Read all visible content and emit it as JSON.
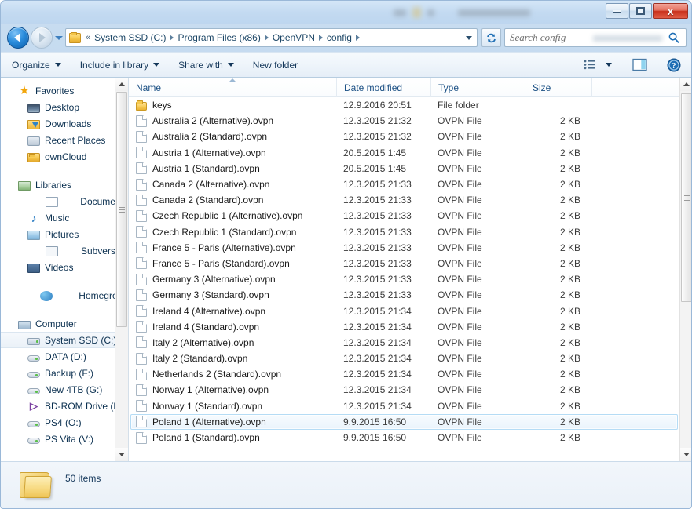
{
  "window": {
    "titlebar_redacted": true,
    "minimize_label": "Minimize",
    "maximize_label": "Maximize",
    "close_label": "x"
  },
  "addressbar": {
    "back_label": "Back",
    "forward_label": "Forward",
    "history_label": "Recent pages",
    "folder_icon": "folder-icon",
    "overflow_chevron": "«",
    "crumbs": [
      {
        "label": "System SSD (C:)"
      },
      {
        "label": "Program Files (x86)"
      },
      {
        "label": "OpenVPN"
      },
      {
        "label": "config"
      }
    ],
    "dropdown_label": "Previous locations",
    "refresh_label": "Refresh",
    "refresh_icon": "refresh-icon"
  },
  "search": {
    "placeholder": "Search config",
    "value": "",
    "icon": "search-icon"
  },
  "toolbar": {
    "items": [
      {
        "label": "Organize",
        "caret": true
      },
      {
        "label": "Include in library",
        "caret": true
      },
      {
        "label": "Share with",
        "caret": true
      },
      {
        "label": "New folder",
        "caret": false
      }
    ],
    "view_icon": "view-list-icon",
    "view_caret_icon": "chevron-down-icon",
    "preview_pane_icon": "preview-pane-icon",
    "help_icon": "help-icon"
  },
  "navpane": {
    "sections": [
      {
        "header": {
          "label": "Favorites",
          "icon": "star-icon",
          "icon_class": "ic-star",
          "glyph": "★"
        },
        "items": [
          {
            "label": "Desktop",
            "icon": "desktop-icon",
            "icon_class": "ic-desktop"
          },
          {
            "label": "Downloads",
            "icon": "downloads-icon",
            "icon_class": "ic-downloads"
          },
          {
            "label": "Recent Places",
            "icon": "recent-places-icon",
            "icon_class": "ic-recent"
          },
          {
            "label": "ownCloud",
            "icon": "folder-icon",
            "icon_class": "ic-folder"
          }
        ]
      },
      {
        "header": {
          "label": "Libraries",
          "icon": "libraries-icon",
          "icon_class": "ic-library",
          "glyph": ""
        },
        "items": [
          {
            "label": "Documents",
            "icon": "documents-icon",
            "icon_class": "ic-doc"
          },
          {
            "label": "Music",
            "icon": "music-icon",
            "icon_class": "ic-music",
            "glyph": "♪"
          },
          {
            "label": "Pictures",
            "icon": "pictures-icon",
            "icon_class": "ic-picture"
          },
          {
            "label": "Subversion",
            "icon": "subversion-icon",
            "icon_class": "ic-subv"
          },
          {
            "label": "Videos",
            "icon": "videos-icon",
            "icon_class": "ic-video"
          }
        ]
      },
      {
        "header": {
          "label": "Homegroup",
          "icon": "homegroup-icon",
          "icon_class": "ic-home",
          "glyph": ""
        },
        "items": []
      },
      {
        "header": {
          "label": "Computer",
          "icon": "computer-icon",
          "icon_class": "ic-computer",
          "glyph": ""
        },
        "items": [
          {
            "label": "System SSD (C:)",
            "icon": "hard-drive-icon",
            "icon_class": "ic-drive-sys",
            "selected": true
          },
          {
            "label": "DATA (D:)",
            "icon": "hard-drive-icon",
            "icon_class": "ic-drive"
          },
          {
            "label": "Backup (F:)",
            "icon": "hard-drive-icon",
            "icon_class": "ic-drive"
          },
          {
            "label": "New 4TB (G:)",
            "icon": "hard-drive-icon",
            "icon_class": "ic-drive"
          },
          {
            "label": "BD-ROM Drive (K",
            "icon": "optical-drive-icon",
            "icon_class": "ic-bd",
            "glyph": "▷"
          },
          {
            "label": "PS4 (O:)",
            "icon": "hard-drive-icon",
            "icon_class": "ic-drive"
          },
          {
            "label": "PS Vita (V:)",
            "icon": "hard-drive-icon",
            "icon_class": "ic-drive"
          }
        ]
      }
    ]
  },
  "filelist": {
    "columns": [
      {
        "id": "name",
        "label": "Name",
        "sorted": true
      },
      {
        "id": "date",
        "label": "Date modified",
        "sorted": false
      },
      {
        "id": "type",
        "label": "Type",
        "sorted": false
      },
      {
        "id": "size",
        "label": "Size",
        "sorted": false
      }
    ],
    "rows": [
      {
        "name": "keys",
        "date": "12.9.2016 20:51",
        "type": "File folder",
        "size": "",
        "kind": "folder"
      },
      {
        "name": "Australia 2 (Alternative).ovpn",
        "date": "12.3.2015 21:32",
        "type": "OVPN File",
        "size": "2 KB",
        "kind": "file"
      },
      {
        "name": "Australia 2 (Standard).ovpn",
        "date": "12.3.2015 21:32",
        "type": "OVPN File",
        "size": "2 KB",
        "kind": "file"
      },
      {
        "name": "Austria 1 (Alternative).ovpn",
        "date": "20.5.2015 1:45",
        "type": "OVPN File",
        "size": "2 KB",
        "kind": "file"
      },
      {
        "name": "Austria 1 (Standard).ovpn",
        "date": "20.5.2015 1:45",
        "type": "OVPN File",
        "size": "2 KB",
        "kind": "file"
      },
      {
        "name": "Canada 2 (Alternative).ovpn",
        "date": "12.3.2015 21:33",
        "type": "OVPN File",
        "size": "2 KB",
        "kind": "file"
      },
      {
        "name": "Canada 2 (Standard).ovpn",
        "date": "12.3.2015 21:33",
        "type": "OVPN File",
        "size": "2 KB",
        "kind": "file"
      },
      {
        "name": "Czech Republic 1 (Alternative).ovpn",
        "date": "12.3.2015 21:33",
        "type": "OVPN File",
        "size": "2 KB",
        "kind": "file"
      },
      {
        "name": "Czech Republic 1 (Standard).ovpn",
        "date": "12.3.2015 21:33",
        "type": "OVPN File",
        "size": "2 KB",
        "kind": "file"
      },
      {
        "name": "France 5 - Paris (Alternative).ovpn",
        "date": "12.3.2015 21:33",
        "type": "OVPN File",
        "size": "2 KB",
        "kind": "file"
      },
      {
        "name": "France 5 - Paris (Standard).ovpn",
        "date": "12.3.2015 21:33",
        "type": "OVPN File",
        "size": "2 KB",
        "kind": "file"
      },
      {
        "name": "Germany 3 (Alternative).ovpn",
        "date": "12.3.2015 21:33",
        "type": "OVPN File",
        "size": "2 KB",
        "kind": "file"
      },
      {
        "name": "Germany 3 (Standard).ovpn",
        "date": "12.3.2015 21:33",
        "type": "OVPN File",
        "size": "2 KB",
        "kind": "file"
      },
      {
        "name": "Ireland 4 (Alternative).ovpn",
        "date": "12.3.2015 21:34",
        "type": "OVPN File",
        "size": "2 KB",
        "kind": "file"
      },
      {
        "name": "Ireland 4 (Standard).ovpn",
        "date": "12.3.2015 21:34",
        "type": "OVPN File",
        "size": "2 KB",
        "kind": "file"
      },
      {
        "name": "Italy 2 (Alternative).ovpn",
        "date": "12.3.2015 21:34",
        "type": "OVPN File",
        "size": "2 KB",
        "kind": "file"
      },
      {
        "name": "Italy 2 (Standard).ovpn",
        "date": "12.3.2015 21:34",
        "type": "OVPN File",
        "size": "2 KB",
        "kind": "file"
      },
      {
        "name": "Netherlands 2 (Standard).ovpn",
        "date": "12.3.2015 21:34",
        "type": "OVPN File",
        "size": "2 KB",
        "kind": "file"
      },
      {
        "name": "Norway 1 (Alternative).ovpn",
        "date": "12.3.2015 21:34",
        "type": "OVPN File",
        "size": "2 KB",
        "kind": "file"
      },
      {
        "name": "Norway 1 (Standard).ovpn",
        "date": "12.3.2015 21:34",
        "type": "OVPN File",
        "size": "2 KB",
        "kind": "file"
      },
      {
        "name": "Poland 1 (Alternative).ovpn",
        "date": "9.9.2015 16:50",
        "type": "OVPN File",
        "size": "2 KB",
        "kind": "file",
        "hovered": true
      },
      {
        "name": "Poland 1 (Standard).ovpn",
        "date": "9.9.2015 16:50",
        "type": "OVPN File",
        "size": "2 KB",
        "kind": "file"
      }
    ]
  },
  "statusbar": {
    "item_count": "50 items",
    "folder_icon": "folder-icon"
  },
  "colors": {
    "accent": "#2b8ddd",
    "crumb_text": "#1c4666",
    "close_button": "#c9311c",
    "folder_yellow": "#f6c74b",
    "selection_border": "#b5dcf5"
  }
}
